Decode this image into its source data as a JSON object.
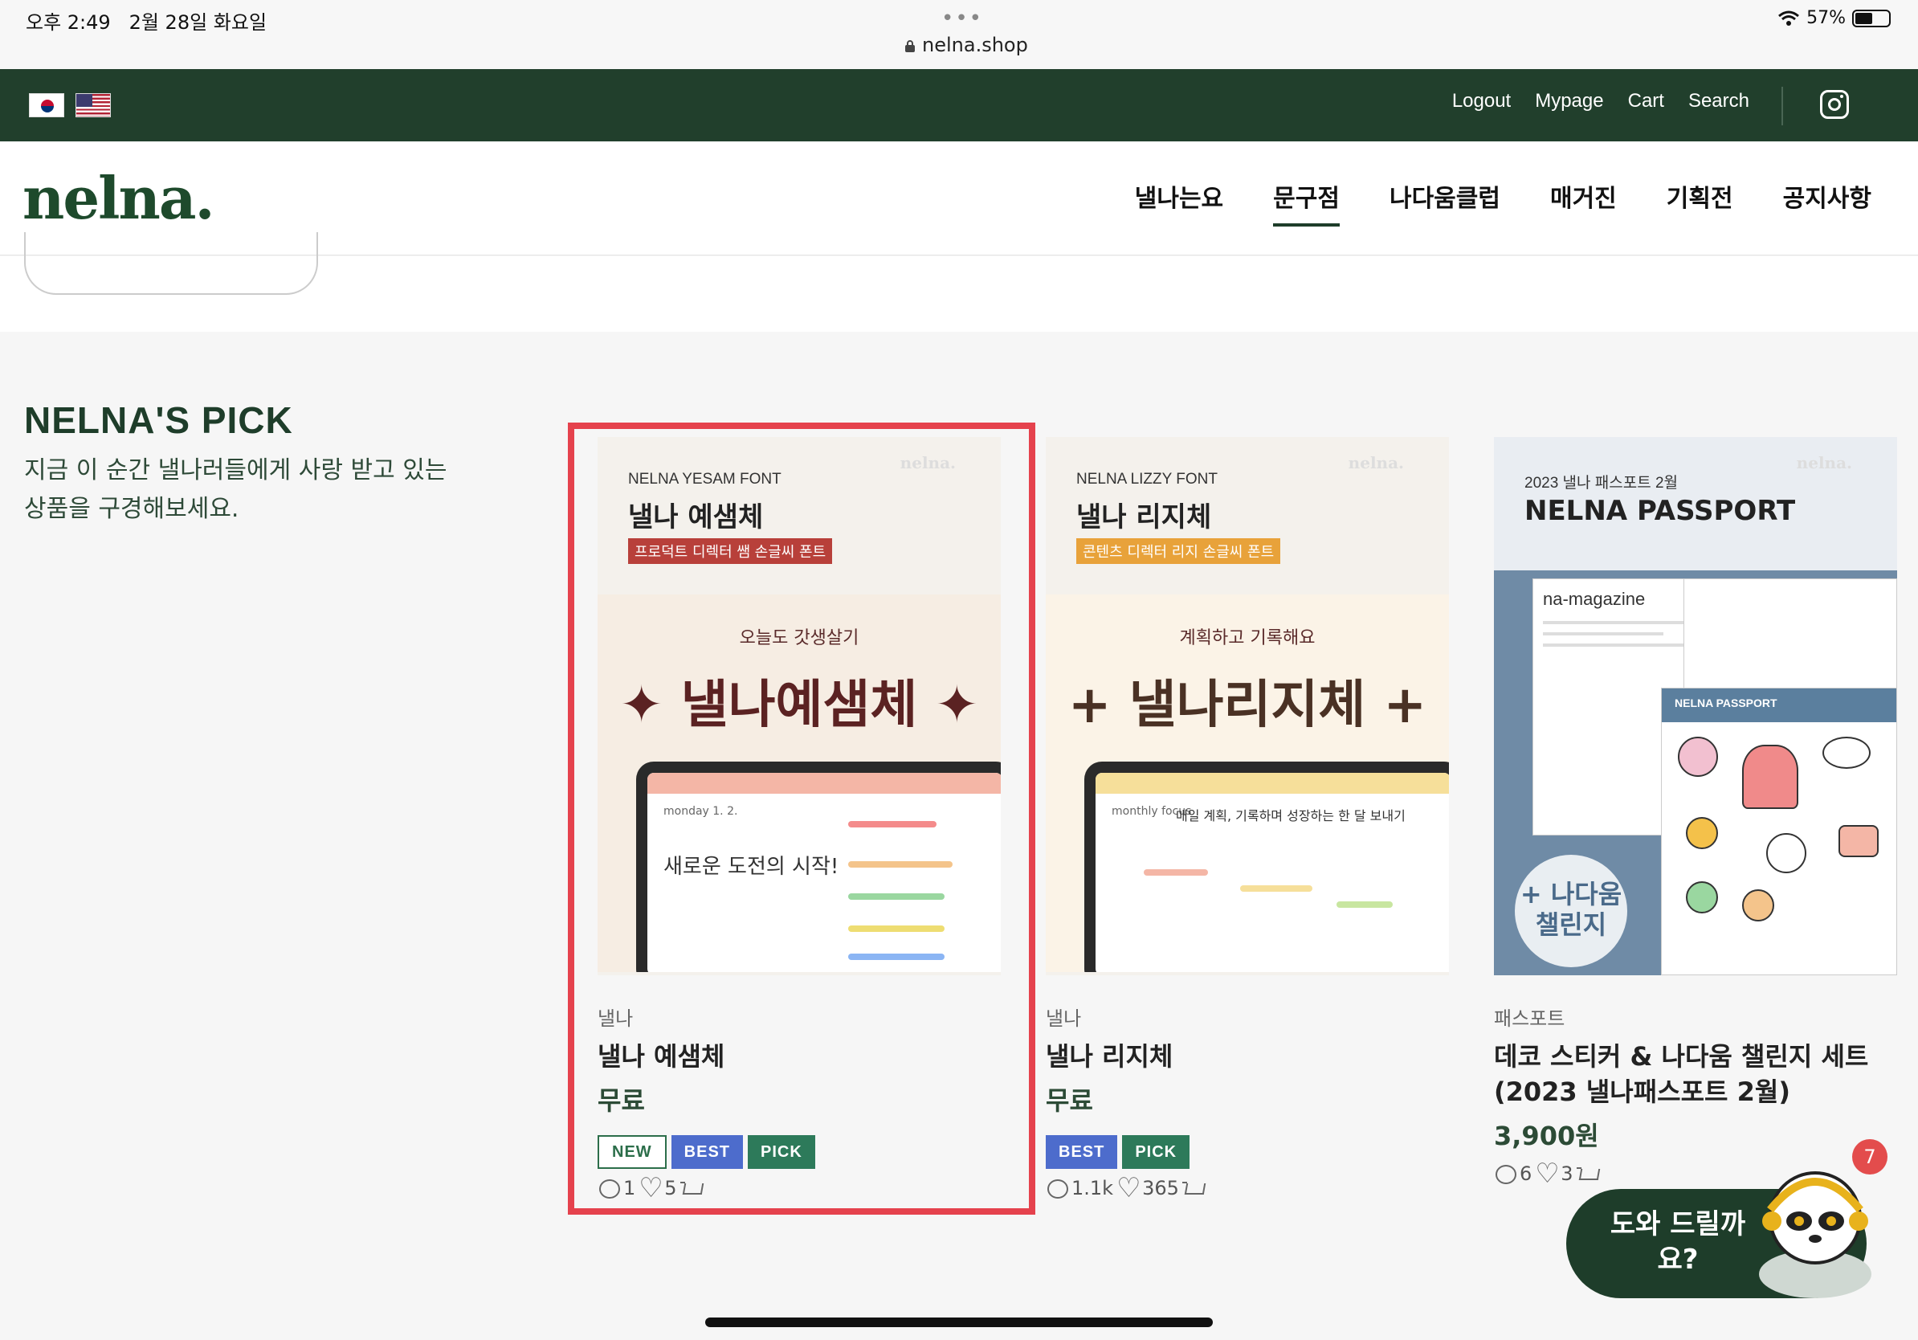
{
  "status": {
    "time": "오후 2:49",
    "date": "2월 28일 화요일",
    "url": "nelna.shop",
    "battery": "57%",
    "battery_level": 0.57
  },
  "topbar": {
    "links": [
      "Logout",
      "Mypage",
      "Cart",
      "Search"
    ],
    "instagram_icon": "instagram-icon",
    "colors": {
      "background": "#213f2c"
    }
  },
  "nav": {
    "logo": "nelna.",
    "items": [
      "낼나는요",
      "문구점",
      "나다움클럽",
      "매거진",
      "기획전",
      "공지사항"
    ],
    "active": "문구점"
  },
  "section": {
    "title": "NELNA'S PICK",
    "subtitle": "지금 이 순간 낼나러들에게 사랑 받고 있는 상품을 구경해보세요."
  },
  "products": [
    {
      "img_sub": "NELNA YESAM FONT",
      "img_title": "낼나 예샘체",
      "img_tag": "프로덕트 디렉터 쌤 손글씨 폰트",
      "img_brand": "nelna.",
      "promo_caption": "오늘도 갓생살기",
      "promo_name": "✦ 낼나예샘체 ✦",
      "promo_hand": "새로운 도전의 시작!",
      "promo_small": "monday 1. 2.",
      "brand": "낼나",
      "name": "낼나 예샘체",
      "price": "무료",
      "badges": [
        "NEW",
        "BEST",
        "PICK"
      ],
      "comments": "1",
      "likes": "5"
    },
    {
      "img_sub": "NELNA LIZZY FONT",
      "img_title": "낼나 리지체",
      "img_tag": "콘텐츠 디렉터 리지 손글씨 폰트",
      "img_brand": "nelna.",
      "promo_caption": "계획하고 기록해요",
      "promo_name": "+ 낼나리지체 +",
      "promo_hand": "매일 계획, 기록하며 성장하는 한 달 보내기",
      "promo_small": "monthly focus",
      "brand": "낼나",
      "name": "낼나 리지체",
      "price": "무료",
      "badges": [
        "BEST",
        "PICK"
      ],
      "comments": "1.1k",
      "likes": "365"
    },
    {
      "img_sub": "2023 낼나 패스포트 2월",
      "img_title": "NELNA PASSPORT",
      "img_brand": "nelna.",
      "mag_title": "na-magazine",
      "pass_header": "NELNA PASSPORT",
      "challenge": "+ 나다움 챌린지",
      "brand": "패스포트",
      "name": "데코 스티커 & 나다움 챌린지 세트 (2023 낼나패스포트 2월)",
      "price": "3,900원",
      "badges": [],
      "comments": "6",
      "likes": "3"
    }
  ],
  "chat": {
    "label": "도와 드릴까요?",
    "count": "7"
  },
  "colors": {
    "brand_green": "#1e3d2a",
    "highlight": "#e5424d",
    "badge_best": "#4d6ccc",
    "badge_pick": "#2d7a5a"
  }
}
